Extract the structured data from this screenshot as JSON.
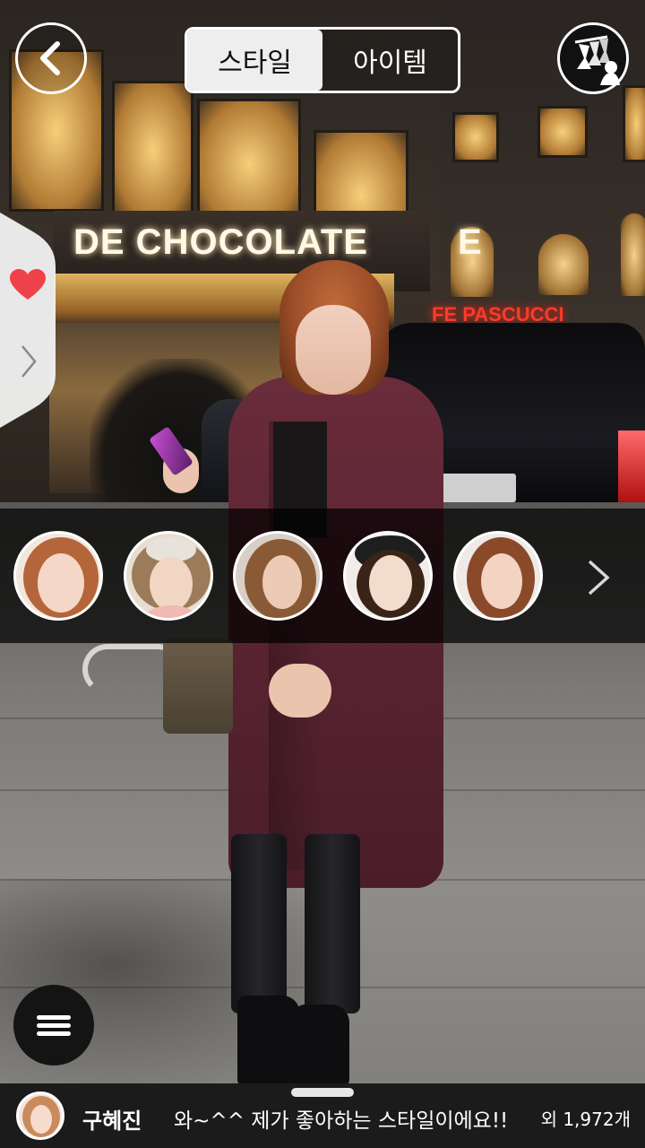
{
  "header": {
    "tabs": [
      {
        "label": "스타일",
        "active": true
      },
      {
        "label": "아이템",
        "active": false
      }
    ],
    "back_icon": "chevron-left-icon",
    "closet_icon": "clothes-hanger-person-icon"
  },
  "background": {
    "store_sign": "DE CHOCOLATE",
    "store_sign_tail": "E",
    "neon_sign": "FE PASCUCCI"
  },
  "side_tab": {
    "heart_icon": "heart-icon",
    "heart_color": "#f0424b",
    "arrow_icon": "chevron-right-icon"
  },
  "avatar_strip": {
    "avatars": [
      {
        "name": "avatar-1",
        "hair": "#b5653a"
      },
      {
        "name": "avatar-2",
        "hair": "#9c7b5a"
      },
      {
        "name": "avatar-3",
        "hair": "#8a5a36"
      },
      {
        "name": "avatar-4",
        "hair": "#3a2418"
      },
      {
        "name": "avatar-5",
        "hair": "#8a4a2a"
      }
    ],
    "next_icon": "chevron-right-icon"
  },
  "menu": {
    "icon": "hamburger-menu-icon"
  },
  "footer": {
    "user_name": "구혜진",
    "message": "와~^^ 제가 좋아하는 스타일이에요!!",
    "count": "외 1,972개"
  }
}
